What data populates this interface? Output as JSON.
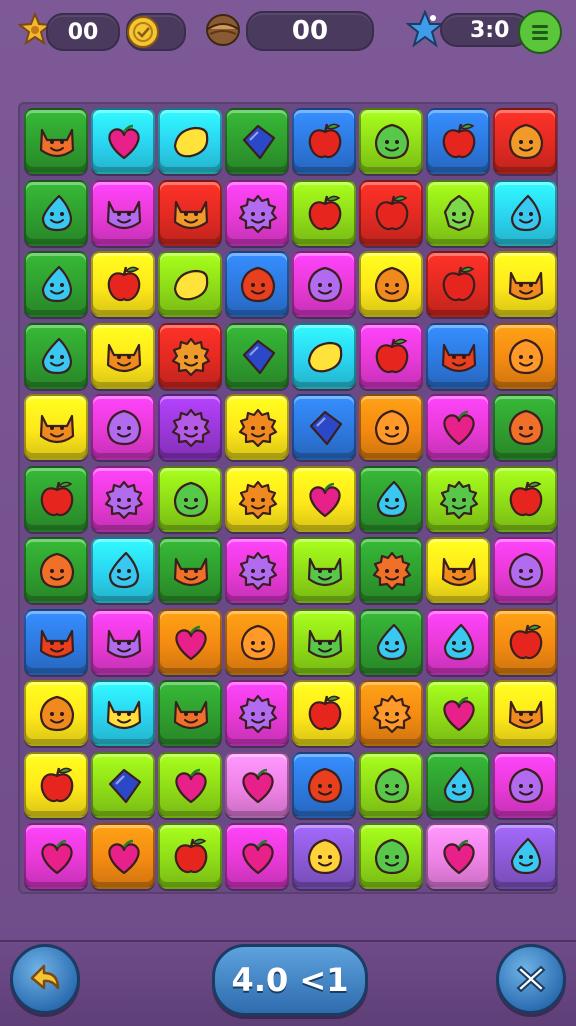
{
  "hud": {
    "star_score": "00",
    "coin_icon": "coin-icon",
    "coin_count": "",
    "nut_icon": "nut-icon",
    "moves": "00",
    "level_score": "3:0",
    "menu_icon": "menu-icon"
  },
  "footer": {
    "back_icon": "back-arrow-icon",
    "center_label": "4.0 <1",
    "close_icon": "close-icon"
  },
  "colors": {
    "dkgreen": "#2f9e2f",
    "blue": "#2e79e0",
    "cyan": "#2ad4f0",
    "red": "#e22a22",
    "magenta": "#e83ad6",
    "lime": "#8fdc18",
    "yellow": "#ffe81a",
    "orange": "#f48a12",
    "purple": "#9a38d8",
    "pink": "#ef82e6",
    "violet": "#8b5ad6"
  },
  "board": {
    "rows": [
      [
        {
          "bg": "dkgreen",
          "c": "cat"
        },
        {
          "bg": "cyan",
          "c": "heart"
        },
        {
          "bg": "cyan",
          "c": "lemon"
        },
        {
          "bg": "dkgreen",
          "c": "gem"
        },
        {
          "bg": "blue",
          "c": "apple"
        },
        {
          "bg": "lime",
          "c": "blob"
        },
        {
          "bg": "blue",
          "c": "apple"
        },
        {
          "bg": "red",
          "c": "blob"
        }
      ],
      [
        {
          "bg": "dkgreen",
          "c": "drop"
        },
        {
          "bg": "magenta",
          "c": "cat"
        },
        {
          "bg": "red",
          "c": "cat"
        },
        {
          "bg": "magenta",
          "c": "fuzz"
        },
        {
          "bg": "lime",
          "c": "apple"
        },
        {
          "bg": "red",
          "c": "apple"
        },
        {
          "bg": "lime",
          "c": "leaf"
        },
        {
          "bg": "cyan",
          "c": "drop"
        }
      ],
      [
        {
          "bg": "dkgreen",
          "c": "drop"
        },
        {
          "bg": "yellow",
          "c": "apple"
        },
        {
          "bg": "lime",
          "c": "lemon"
        },
        {
          "bg": "blue",
          "c": "blob"
        },
        {
          "bg": "magenta",
          "c": "blob"
        },
        {
          "bg": "yellow",
          "c": "blob"
        },
        {
          "bg": "red",
          "c": "apple"
        },
        {
          "bg": "yellow",
          "c": "cat"
        }
      ],
      [
        {
          "bg": "dkgreen",
          "c": "drop"
        },
        {
          "bg": "yellow",
          "c": "cat"
        },
        {
          "bg": "red",
          "c": "fuzz"
        },
        {
          "bg": "dkgreen",
          "c": "gem"
        },
        {
          "bg": "cyan",
          "c": "lemon"
        },
        {
          "bg": "magenta",
          "c": "apple"
        },
        {
          "bg": "blue",
          "c": "cat"
        },
        {
          "bg": "orange",
          "c": "blob"
        }
      ],
      [
        {
          "bg": "yellow",
          "c": "cat"
        },
        {
          "bg": "magenta",
          "c": "blob"
        },
        {
          "bg": "purple",
          "c": "fuzz"
        },
        {
          "bg": "yellow",
          "c": "fuzz"
        },
        {
          "bg": "blue",
          "c": "gem"
        },
        {
          "bg": "orange",
          "c": "blob"
        },
        {
          "bg": "magenta",
          "c": "heart"
        },
        {
          "bg": "dkgreen",
          "c": "blob"
        }
      ],
      [
        {
          "bg": "dkgreen",
          "c": "apple"
        },
        {
          "bg": "magenta",
          "c": "fuzz"
        },
        {
          "bg": "lime",
          "c": "blob"
        },
        {
          "bg": "yellow",
          "c": "fuzz"
        },
        {
          "bg": "yellow",
          "c": "heart"
        },
        {
          "bg": "dkgreen",
          "c": "drop"
        },
        {
          "bg": "lime",
          "c": "fuzz"
        },
        {
          "bg": "lime",
          "c": "apple"
        }
      ],
      [
        {
          "bg": "dkgreen",
          "c": "blob"
        },
        {
          "bg": "cyan",
          "c": "drop"
        },
        {
          "bg": "dkgreen",
          "c": "cat"
        },
        {
          "bg": "magenta",
          "c": "fuzz"
        },
        {
          "bg": "lime",
          "c": "cat"
        },
        {
          "bg": "dkgreen",
          "c": "fuzz"
        },
        {
          "bg": "yellow",
          "c": "cat"
        },
        {
          "bg": "magenta",
          "c": "blob"
        }
      ],
      [
        {
          "bg": "blue",
          "c": "cat"
        },
        {
          "bg": "magenta",
          "c": "cat"
        },
        {
          "bg": "orange",
          "c": "heart"
        },
        {
          "bg": "orange",
          "c": "blob"
        },
        {
          "bg": "lime",
          "c": "cat"
        },
        {
          "bg": "dkgreen",
          "c": "drop"
        },
        {
          "bg": "magenta",
          "c": "drop"
        },
        {
          "bg": "orange",
          "c": "apple"
        }
      ],
      [
        {
          "bg": "yellow",
          "c": "blob"
        },
        {
          "bg": "cyan",
          "c": "cat"
        },
        {
          "bg": "dkgreen",
          "c": "cat"
        },
        {
          "bg": "magenta",
          "c": "fuzz"
        },
        {
          "bg": "yellow",
          "c": "apple"
        },
        {
          "bg": "orange",
          "c": "fuzz"
        },
        {
          "bg": "lime",
          "c": "heart"
        },
        {
          "bg": "yellow",
          "c": "cat"
        }
      ],
      [
        {
          "bg": "yellow",
          "c": "apple"
        },
        {
          "bg": "lime",
          "c": "gem"
        },
        {
          "bg": "lime",
          "c": "heart"
        },
        {
          "bg": "pink",
          "c": "heart"
        },
        {
          "bg": "blue",
          "c": "blob"
        },
        {
          "bg": "lime",
          "c": "blob"
        },
        {
          "bg": "dkgreen",
          "c": "drop"
        },
        {
          "bg": "magenta",
          "c": "blob"
        }
      ],
      [
        {
          "bg": "magenta",
          "c": "heart"
        },
        {
          "bg": "orange",
          "c": "heart"
        },
        {
          "bg": "lime",
          "c": "apple"
        },
        {
          "bg": "magenta",
          "c": "heart"
        },
        {
          "bg": "violet",
          "c": "blob"
        },
        {
          "bg": "lime",
          "c": "blob"
        },
        {
          "bg": "pink",
          "c": "heart"
        },
        {
          "bg": "violet",
          "c": "drop"
        }
      ]
    ]
  }
}
